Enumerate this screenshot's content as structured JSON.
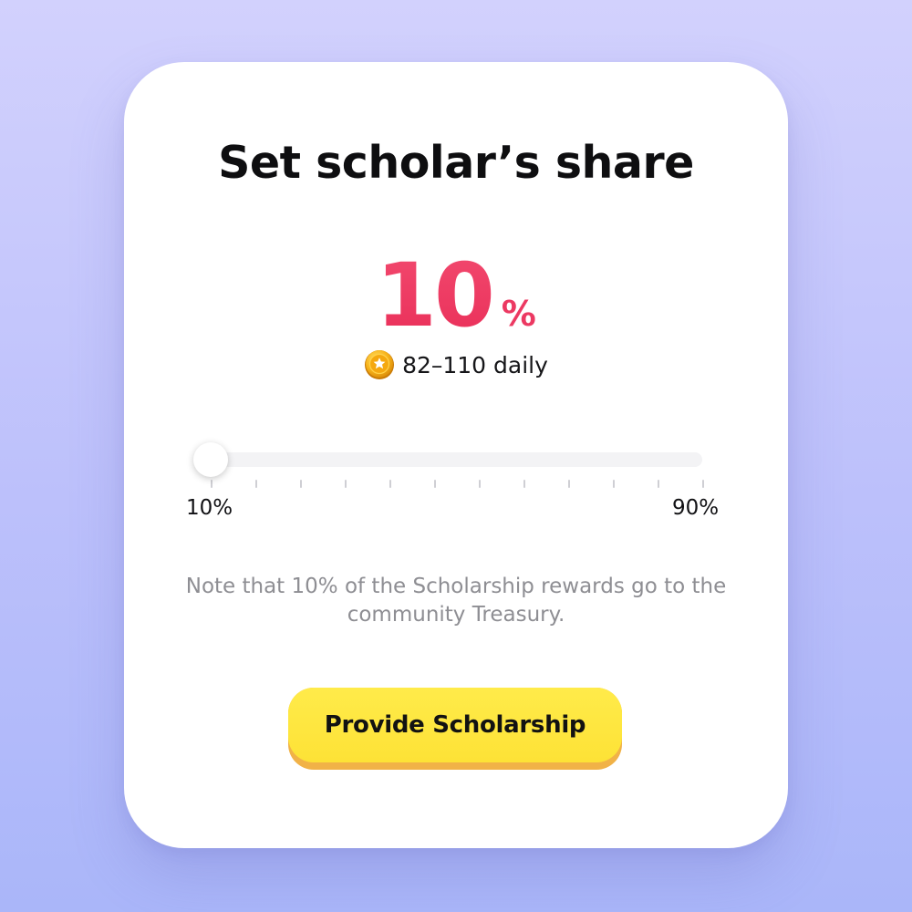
{
  "dialog": {
    "title": "Set scholar’s share",
    "share_value": "10",
    "share_unit": "%",
    "reward_icon": "star-coin-icon",
    "reward_text": "82–110 daily",
    "note": "Note that 10% of the Scholarship rewards go to the community Treasury.",
    "cta_label": "Provide Scholarship"
  },
  "slider": {
    "min_label": "10%",
    "max_label": "90%",
    "min": 10,
    "max": 90,
    "value": 10,
    "tick_count": 12
  },
  "colors": {
    "accent": "#ee3a63",
    "button": "#fde236",
    "button_shadow": "#f1b247",
    "note_text": "#8e8e93"
  }
}
